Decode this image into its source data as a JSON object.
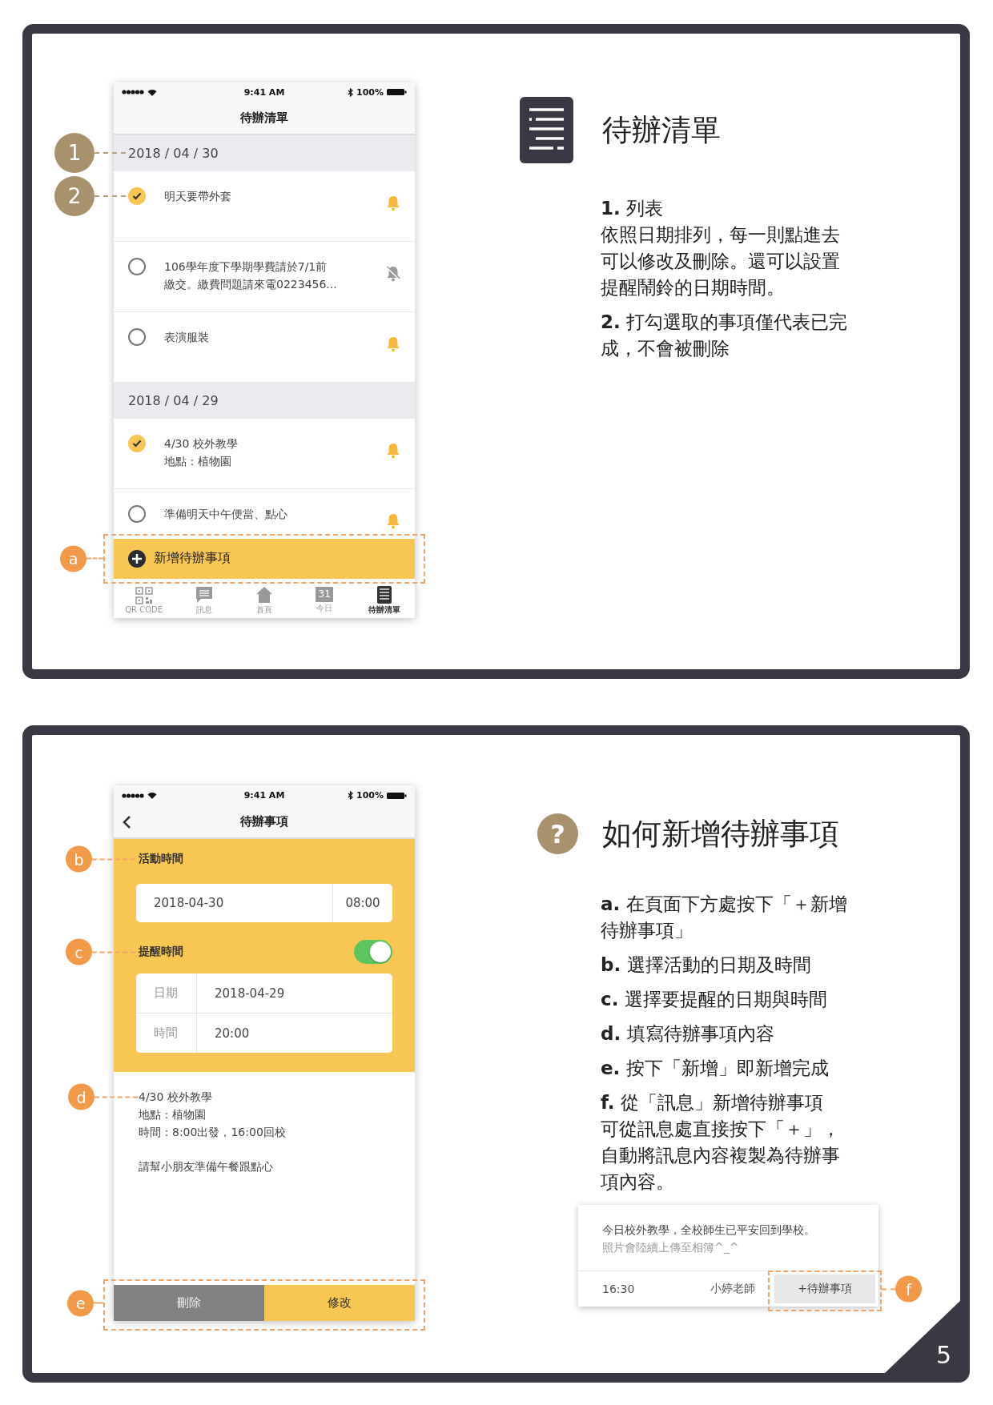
{
  "todo_list_panel": {
    "phone": {
      "status_bar": {
        "time": "9:41 AM",
        "battery": "100%"
      },
      "title": "待辦清單",
      "sections": [
        {
          "date": "2018 / 04 / 30",
          "callout": {
            "label": "1",
            "kind": "step"
          },
          "items": [
            {
              "lines": [
                "明天要帶外套"
              ],
              "checked": true,
              "alarm": true,
              "callout": {
                "label": "2",
                "kind": "step"
              }
            },
            {
              "lines": [
                "106學年度下學期學費請於7/1前",
                "繳交。繳費問題請來電0223456..."
              ],
              "checked": false,
              "alarm": false
            },
            {
              "lines": [
                "表演服裝"
              ],
              "checked": false,
              "alarm": true
            }
          ]
        },
        {
          "date": "2018 / 04 / 29",
          "items": [
            {
              "lines": [
                "4/30 校外教學",
                "地點：植物園"
              ],
              "checked": true,
              "alarm": true
            },
            {
              "lines": [
                "準備明天中午便當、點心"
              ],
              "checked": false,
              "alarm": true
            }
          ]
        }
      ],
      "add_button": {
        "label": "新增待辦事項",
        "callout": {
          "label": "a",
          "kind": "action"
        }
      },
      "tabs": [
        {
          "kind": "qr",
          "label": "QR CODE",
          "selected": false
        },
        {
          "kind": "message",
          "label": "訊息",
          "selected": false
        },
        {
          "kind": "home",
          "label": "首頁",
          "selected": false
        },
        {
          "kind": "calendar",
          "label": "今日",
          "icon_text": "31",
          "selected": false
        },
        {
          "kind": "list",
          "label": "待辦清單",
          "selected": true
        }
      ]
    },
    "info": {
      "kind": "list",
      "title": "待辦清單",
      "paragraphs": [
        {
          "marker": "1.",
          "lines": [
            "列表",
            "依照日期排列，每一則點進去",
            "可以修改及刪除。還可以設置",
            "提醒鬧鈴的日期時間。"
          ]
        },
        {
          "marker": "2.",
          "lines": [
            "打勾選取的事項僅代表已完",
            "成，不會被刪除"
          ]
        }
      ]
    }
  },
  "add_todo_panel": {
    "phone": {
      "status_bar": {
        "time": "9:41 AM",
        "battery": "100%"
      },
      "title": "待辦事項",
      "activity": {
        "label": "活動時間",
        "callout": {
          "label": "b",
          "kind": "action"
        },
        "date": "2018-04-30",
        "time": "08:00"
      },
      "reminder": {
        "label": "提醒時間",
        "callout": {
          "label": "c",
          "kind": "action"
        },
        "on": true,
        "rows": [
          {
            "label": "日期",
            "value": "2018-04-29"
          },
          {
            "label": "時間",
            "value": "20:00"
          }
        ]
      },
      "note": {
        "callout": {
          "label": "d",
          "kind": "action"
        },
        "lines": [
          "4/30 校外教學",
          "地點：植物園",
          "時間：8:00出發，16:00回校"
        ],
        "remark": "請幫小朋友準備午餐跟點心"
      },
      "buttons_callout": {
        "label": "e",
        "kind": "action"
      },
      "buttons": [
        {
          "kind": "delete",
          "label": "刪除"
        },
        {
          "kind": "edit",
          "label": "修改"
        }
      ]
    },
    "info": {
      "kind": "question",
      "icon": "?",
      "title": "如何新增待辦事項",
      "paragraphs": [
        {
          "marker": "a.",
          "lines": [
            "在頁面下方處按下「＋新增",
            "待辦事項」"
          ]
        },
        {
          "marker": "b.",
          "lines": [
            "選擇活動的日期及時間"
          ]
        },
        {
          "marker": "c.",
          "lines": [
            "選擇要提醒的日期與時間"
          ]
        },
        {
          "marker": "d.",
          "lines": [
            "填寫待辦事項內容"
          ]
        },
        {
          "marker": "e.",
          "lines": [
            "按下「新增」即新增完成"
          ]
        },
        {
          "marker": "f.",
          "lines": [
            "從「訊息」新增待辦事項",
            "可從訊息處直接按下「＋」，",
            "自動將訊息內容複製為待辦事",
            "項內容。"
          ]
        }
      ],
      "message_card": {
        "text": "今日校外教學，全校師生已平安回到學校。",
        "subtext": "照片會陸續上傳至相簿^_^",
        "time": "16:30",
        "sender": "小婷老師",
        "button": "+待辦事項",
        "callout": {
          "label": "f",
          "kind": "action"
        }
      }
    },
    "page_number": "5"
  }
}
